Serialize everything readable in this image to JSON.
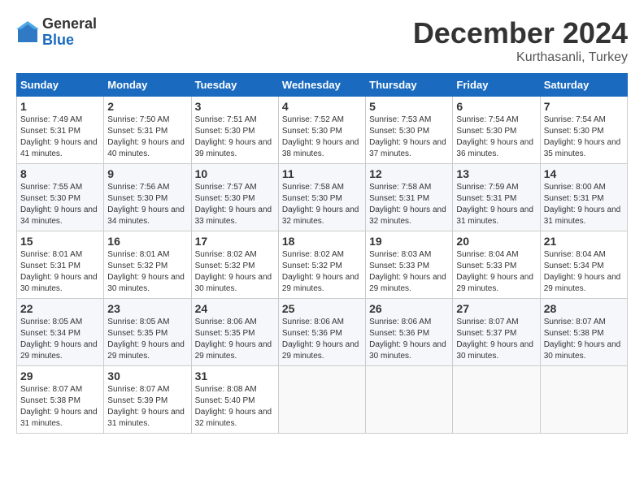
{
  "logo": {
    "general": "General",
    "blue": "Blue"
  },
  "header": {
    "month": "December 2024",
    "location": "Kurthasanli, Turkey"
  },
  "weekdays": [
    "Sunday",
    "Monday",
    "Tuesday",
    "Wednesday",
    "Thursday",
    "Friday",
    "Saturday"
  ],
  "weeks": [
    [
      {
        "day": "1",
        "sunrise": "7:49 AM",
        "sunset": "5:31 PM",
        "daylight": "9 hours and 41 minutes."
      },
      {
        "day": "2",
        "sunrise": "7:50 AM",
        "sunset": "5:31 PM",
        "daylight": "9 hours and 40 minutes."
      },
      {
        "day": "3",
        "sunrise": "7:51 AM",
        "sunset": "5:30 PM",
        "daylight": "9 hours and 39 minutes."
      },
      {
        "day": "4",
        "sunrise": "7:52 AM",
        "sunset": "5:30 PM",
        "daylight": "9 hours and 38 minutes."
      },
      {
        "day": "5",
        "sunrise": "7:53 AM",
        "sunset": "5:30 PM",
        "daylight": "9 hours and 37 minutes."
      },
      {
        "day": "6",
        "sunrise": "7:54 AM",
        "sunset": "5:30 PM",
        "daylight": "9 hours and 36 minutes."
      },
      {
        "day": "7",
        "sunrise": "7:54 AM",
        "sunset": "5:30 PM",
        "daylight": "9 hours and 35 minutes."
      }
    ],
    [
      {
        "day": "8",
        "sunrise": "7:55 AM",
        "sunset": "5:30 PM",
        "daylight": "9 hours and 34 minutes."
      },
      {
        "day": "9",
        "sunrise": "7:56 AM",
        "sunset": "5:30 PM",
        "daylight": "9 hours and 34 minutes."
      },
      {
        "day": "10",
        "sunrise": "7:57 AM",
        "sunset": "5:30 PM",
        "daylight": "9 hours and 33 minutes."
      },
      {
        "day": "11",
        "sunrise": "7:58 AM",
        "sunset": "5:30 PM",
        "daylight": "9 hours and 32 minutes."
      },
      {
        "day": "12",
        "sunrise": "7:58 AM",
        "sunset": "5:31 PM",
        "daylight": "9 hours and 32 minutes."
      },
      {
        "day": "13",
        "sunrise": "7:59 AM",
        "sunset": "5:31 PM",
        "daylight": "9 hours and 31 minutes."
      },
      {
        "day": "14",
        "sunrise": "8:00 AM",
        "sunset": "5:31 PM",
        "daylight": "9 hours and 31 minutes."
      }
    ],
    [
      {
        "day": "15",
        "sunrise": "8:01 AM",
        "sunset": "5:31 PM",
        "daylight": "9 hours and 30 minutes."
      },
      {
        "day": "16",
        "sunrise": "8:01 AM",
        "sunset": "5:32 PM",
        "daylight": "9 hours and 30 minutes."
      },
      {
        "day": "17",
        "sunrise": "8:02 AM",
        "sunset": "5:32 PM",
        "daylight": "9 hours and 30 minutes."
      },
      {
        "day": "18",
        "sunrise": "8:02 AM",
        "sunset": "5:32 PM",
        "daylight": "9 hours and 29 minutes."
      },
      {
        "day": "19",
        "sunrise": "8:03 AM",
        "sunset": "5:33 PM",
        "daylight": "9 hours and 29 minutes."
      },
      {
        "day": "20",
        "sunrise": "8:04 AM",
        "sunset": "5:33 PM",
        "daylight": "9 hours and 29 minutes."
      },
      {
        "day": "21",
        "sunrise": "8:04 AM",
        "sunset": "5:34 PM",
        "daylight": "9 hours and 29 minutes."
      }
    ],
    [
      {
        "day": "22",
        "sunrise": "8:05 AM",
        "sunset": "5:34 PM",
        "daylight": "9 hours and 29 minutes."
      },
      {
        "day": "23",
        "sunrise": "8:05 AM",
        "sunset": "5:35 PM",
        "daylight": "9 hours and 29 minutes."
      },
      {
        "day": "24",
        "sunrise": "8:06 AM",
        "sunset": "5:35 PM",
        "daylight": "9 hours and 29 minutes."
      },
      {
        "day": "25",
        "sunrise": "8:06 AM",
        "sunset": "5:36 PM",
        "daylight": "9 hours and 29 minutes."
      },
      {
        "day": "26",
        "sunrise": "8:06 AM",
        "sunset": "5:36 PM",
        "daylight": "9 hours and 30 minutes."
      },
      {
        "day": "27",
        "sunrise": "8:07 AM",
        "sunset": "5:37 PM",
        "daylight": "9 hours and 30 minutes."
      },
      {
        "day": "28",
        "sunrise": "8:07 AM",
        "sunset": "5:38 PM",
        "daylight": "9 hours and 30 minutes."
      }
    ],
    [
      {
        "day": "29",
        "sunrise": "8:07 AM",
        "sunset": "5:38 PM",
        "daylight": "9 hours and 31 minutes."
      },
      {
        "day": "30",
        "sunrise": "8:07 AM",
        "sunset": "5:39 PM",
        "daylight": "9 hours and 31 minutes."
      },
      {
        "day": "31",
        "sunrise": "8:08 AM",
        "sunset": "5:40 PM",
        "daylight": "9 hours and 32 minutes."
      },
      null,
      null,
      null,
      null
    ]
  ]
}
